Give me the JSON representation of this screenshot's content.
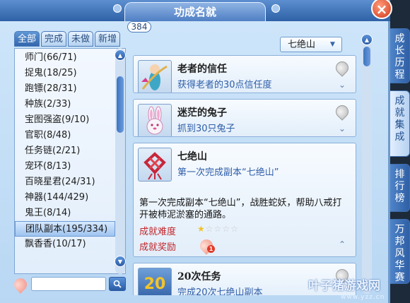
{
  "window": {
    "title": "功成名就",
    "close_label": "×"
  },
  "filter_tabs": [
    {
      "label": "全部",
      "active": true
    },
    {
      "label": "完成",
      "active": false
    },
    {
      "label": "未做",
      "active": false
    },
    {
      "label": "新增",
      "active": false
    }
  ],
  "count_badge": "384",
  "categories": [
    "师门(66/71)",
    "捉鬼(18/25)",
    "跑镖(28/31)",
    "种族(2/33)",
    "宝图强盗(9/10)",
    "官职(8/48)",
    "任务链(2/21)",
    "宠环(8/13)",
    "百晓星君(24/31)",
    "神器(144/429)",
    "鬼王(8/14)",
    "团队副本(195/334)",
    "飘香香(10/17)"
  ],
  "selected_category": "团队副本(195/334)",
  "search": {
    "placeholder": "",
    "button_icon": "search-icon"
  },
  "dropdown": {
    "selected": "七绝山",
    "arrow": "▼"
  },
  "achievements": [
    {
      "title": "老者的信任",
      "subtitle": "获得老者的30点信任度",
      "icon": "fairy-icon",
      "expanded": false
    },
    {
      "title": "迷茫的兔子",
      "subtitle": "抓到30只兔子",
      "icon": "rabbit-icon",
      "expanded": false
    },
    {
      "title": "七绝山",
      "subtitle": "第一次完成副本“七绝山”",
      "icon": "knot-icon",
      "expanded": true,
      "description": "第一次完成副本“七绝山”，战胜蛇妖，帮助八戒打开被柿泥淤塞的通路。",
      "difficulty_label": "成就难度",
      "difficulty_stars": 1,
      "difficulty_max": 5,
      "reward_label": "成就奖励",
      "reward_count": "1"
    },
    {
      "title": "20次任务",
      "subtitle": "完成20次七绝山副本",
      "icon": "number-20-icon",
      "icon_text": "20",
      "expanded": false
    }
  ],
  "side_tabs": [
    {
      "label": "成长历程",
      "active": false
    },
    {
      "label": "成就集成",
      "active": true
    },
    {
      "label": "排行榜",
      "active": false
    },
    {
      "label": "万邦风华赛",
      "active": false
    }
  ],
  "watermark": {
    "brand": "叶子猪游戏网",
    "url": "www.yzz.cn"
  },
  "colors": {
    "accent": "#2e61a6",
    "panel": "#cfe6fa",
    "highlight": "#c1262a"
  }
}
